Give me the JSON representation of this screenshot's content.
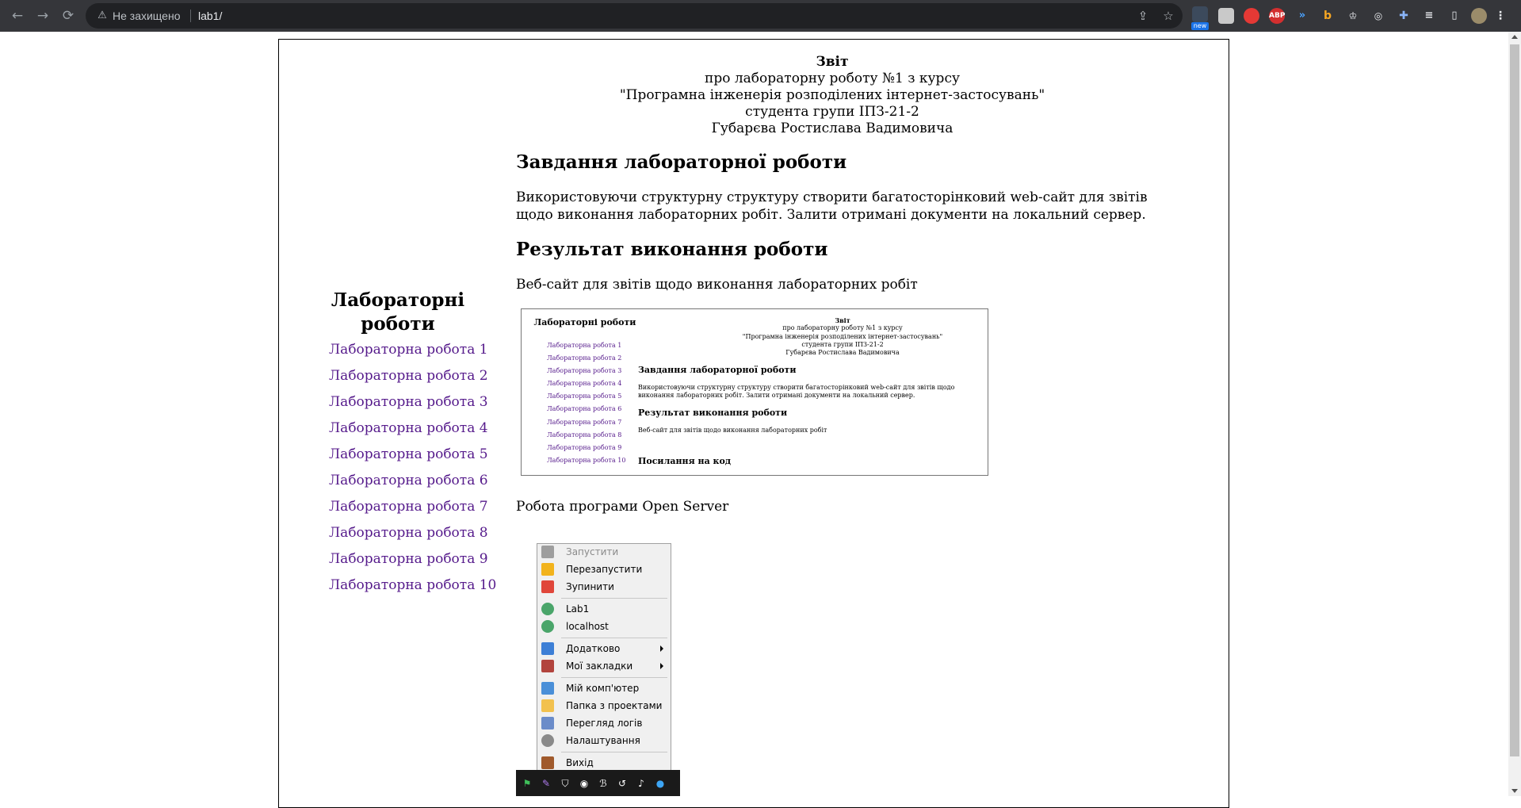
{
  "browser": {
    "address_warning": "Не захищено",
    "url": "lab1/",
    "extensions": [
      "share-icon",
      "star-icon",
      "new-extension-icon",
      "screenshot-icon",
      "recorder-icon",
      "adblock-icon",
      "translate-icon",
      "bing-icon",
      "reader-icon",
      "glasses-icon",
      "puzzle-icon",
      "media-icon",
      "sidepanel-icon",
      "profile-avatar"
    ],
    "new_badge": "new",
    "adblock_label": "ABP"
  },
  "report": {
    "title": "Звіт",
    "line1": "про лабораторну роботу №1 з курсу",
    "line2": "\"Програмна інженерія розподілених інтернет-застосувань\"",
    "line3": "студента групи ІПЗ-21-2",
    "line4": "Губарєва Ростислава Вадимовича"
  },
  "sidebar": {
    "title": "Лабораторні роботи",
    "items": [
      "Лабораторна робота 1",
      "Лабораторна робота 2",
      "Лабораторна робота 3",
      "Лабораторна робота 4",
      "Лабораторна робота 5",
      "Лабораторна робота 6",
      "Лабораторна робота 7",
      "Лабораторна робота 8",
      "Лабораторна робота 9",
      "Лабораторна робота 10"
    ]
  },
  "content": {
    "task_heading": "Завдання лабораторної роботи",
    "task_text": "Використовуючи структурну структуру створити багатосторінковий web-сайт для звітів щодо виконання лабораторних робіт. Залити отримані документи на локальний сервер.",
    "result_heading": "Результат виконання роботи",
    "result_text": "Веб-сайт для звітів щодо виконання лабораторних робіт",
    "os_caption": "Робота програми Open Server"
  },
  "thumbnail": {
    "sidebar_title": "Лабораторні роботи",
    "items": [
      "Лабораторна робота 1",
      "Лабораторна робота 2",
      "Лабораторна робота 3",
      "Лабораторна робота 4",
      "Лабораторна робота 5",
      "Лабораторна робота 6",
      "Лабораторна робота 7",
      "Лабораторна робота 8",
      "Лабораторна робота 9",
      "Лабораторна робота 10"
    ],
    "title": "Звіт",
    "line1": "про лабораторну роботу №1 з курсу",
    "line2": "\"Програмна інженерія розподілених інтернет-застосувань\"",
    "line3": "студента групи ІПЗ-21-2",
    "line4": "Губарєва Ростислава Вадимовича",
    "task_heading": "Завдання лабораторної роботи",
    "task_text": "Використовуючи структурну структуру створити багатосторінковий web-сайт для звітів щодо виконання лабораторних робіт. Залити отримані документи на локальний сервер.",
    "result_heading": "Результат виконання роботи",
    "result_text": "Веб-сайт для звітів щодо виконання лабораторних робіт",
    "code_heading": "Посилання на код"
  },
  "menu": {
    "items": [
      {
        "label": "Запустити",
        "icon": "gray-flag-icon",
        "color": "#9e9e9e",
        "disabled": true
      },
      {
        "label": "Перезапустити",
        "icon": "yellow-flag-icon",
        "color": "#f2b31c",
        "disabled": false
      },
      {
        "label": "Зупинити",
        "icon": "red-flag-icon",
        "color": "#e0463a",
        "disabled": false
      },
      {
        "label": "Lab1",
        "icon": "globe-icon",
        "color": "#4aa56a",
        "disabled": false
      },
      {
        "label": "localhost",
        "icon": "globe-icon",
        "color": "#4aa56a",
        "disabled": false
      },
      {
        "label": "Додатково",
        "icon": "shapes-icon",
        "color": "#3d7fd6",
        "disabled": false,
        "submenu": true
      },
      {
        "label": "Мої закладки",
        "icon": "book-icon",
        "color": "#b2443d",
        "disabled": false,
        "submenu": true
      },
      {
        "label": "Мій комп'ютер",
        "icon": "computer-icon",
        "color": "#4a8fd8",
        "disabled": false
      },
      {
        "label": "Папка з проектами",
        "icon": "folder-icon",
        "color": "#f2c14e",
        "disabled": false
      },
      {
        "label": "Перегляд логів",
        "icon": "log-icon",
        "color": "#6b8cc9",
        "disabled": false
      },
      {
        "label": "Налаштування",
        "icon": "gear-icon",
        "color": "#8a8a8a",
        "disabled": false
      },
      {
        "label": "Вихід",
        "icon": "exit-door-icon",
        "color": "#a05a2c",
        "disabled": false
      }
    ]
  },
  "taskbar": {
    "icons": [
      "green-flag-icon",
      "feather-icon",
      "shield-icon",
      "copilot-icon",
      "bing-icon",
      "refresh-icon",
      "microphone-icon",
      "globe-icon"
    ]
  }
}
